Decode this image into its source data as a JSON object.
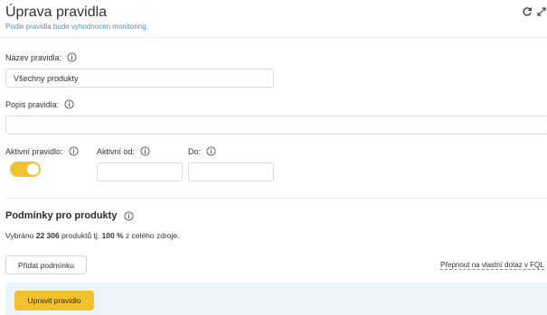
{
  "header": {
    "title": "Úprava pravidla",
    "subtitle": "Podle pravidla bude vyhodnocen monitoring."
  },
  "form": {
    "name": {
      "label": "Název pravidla:",
      "value": "Všechny produkty"
    },
    "description": {
      "label": "Popis pravidla:",
      "value": ""
    },
    "active": {
      "label": "Aktivní pravidlo:",
      "on": true
    },
    "active_from": {
      "label": "Aktivní od:",
      "value": ""
    },
    "active_to": {
      "label": "Do:",
      "value": ""
    }
  },
  "conditions": {
    "title": "Podmínky pro produkty",
    "summary_prefix": "Vybráno ",
    "count": "22 306",
    "summary_mid": " produktů tj. ",
    "percent": "100 %",
    "summary_suffix": " z celého zdroje.",
    "add_button": "Přidat podmínku",
    "switch_link": "Přepnout na vlastní dotaz v FQL"
  },
  "footer": {
    "submit_button": "Upravit pravidlo"
  },
  "colors": {
    "accent": "#f2c12e",
    "subtitle": "#4f8fc7",
    "footer_bg": "#eef4fb"
  }
}
